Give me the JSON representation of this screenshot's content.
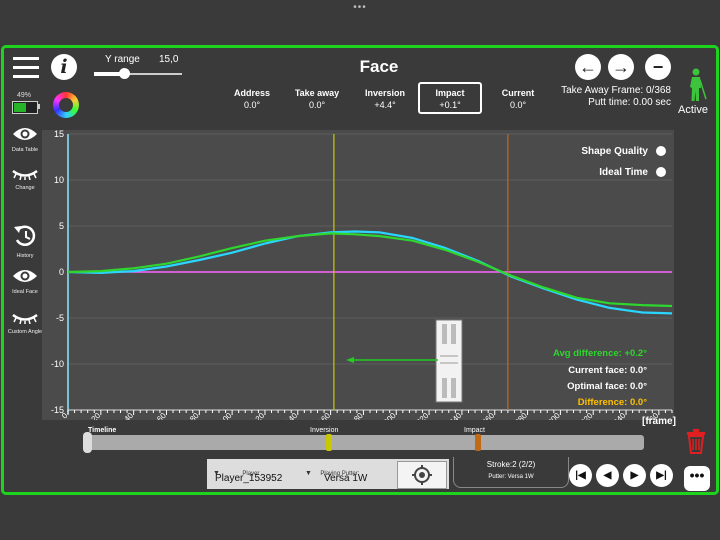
{
  "header": {
    "title": "Face",
    "y_range_label": "Y range",
    "y_range_value": "15,0",
    "battery": "49%",
    "status": "Active"
  },
  "metrics": [
    {
      "label": "Address",
      "value": "0.0°"
    },
    {
      "label": "Take away",
      "value": "0.0°"
    },
    {
      "label": "Inversion",
      "value": "+4.4°"
    },
    {
      "label": "Impact",
      "value": "+0.1°",
      "selected": true
    },
    {
      "label": "Current",
      "value": "0.0°"
    }
  ],
  "take_away": {
    "frame": "Take Away Frame: 0/368",
    "putt_time": "Putt time: 0.00 sec"
  },
  "side_menu": [
    {
      "label": "Data Table",
      "icon": "eye-icon"
    },
    {
      "label": "Change",
      "icon": "closed-eye-icon"
    },
    {
      "label": "History",
      "icon": "history-icon"
    },
    {
      "label": "Ideal Face",
      "icon": "eye-icon"
    },
    {
      "label": "Custom Angle",
      "icon": "closed-eye-icon"
    }
  ],
  "toggles": {
    "shape_quality": "Shape Quality",
    "ideal_time": "Ideal Time"
  },
  "stats": {
    "avg_difference": "Avg difference: +0.2°",
    "current_face": "Current face: 0.0°",
    "optimal_face": "Optimal face: 0.0°",
    "difference": "Difference: 0.0°"
  },
  "x_unit": "[frame]",
  "timeline": {
    "label": "Timeline",
    "inversion": "Inversion",
    "impact": "Impact"
  },
  "player": {
    "player_label": "Player",
    "player_value": "Player_153952",
    "putter_label": "Playing Putter:",
    "putter_value": "Versa 1W"
  },
  "stroke": {
    "main": "Stroke:2 (2/2)",
    "putter": "Putter: Versa 1W"
  },
  "colors": {
    "frame": "#1ed31e",
    "series_current": "#29d6ff",
    "series_ideal": "#2ed62e",
    "zero_line": "#ff66ff",
    "inversion_line": "#c8c800",
    "impact_line": "#c06a18",
    "difference": "#ffc000"
  },
  "chart_data": {
    "type": "line",
    "xlabel": "[frame]",
    "xlim": [
      0,
      368
    ],
    "ylim": [
      -15,
      15
    ],
    "x_ticks": [
      0,
      20,
      40,
      60,
      80,
      100,
      120,
      140,
      160,
      180,
      200,
      220,
      240,
      260,
      280,
      300,
      320,
      340,
      360
    ],
    "y_ticks": [
      -15,
      -10,
      -5,
      0,
      5,
      10,
      15
    ],
    "markers": [
      {
        "name": "Inversion",
        "x": 162
      },
      {
        "name": "Impact",
        "x": 268
      }
    ],
    "series": [
      {
        "name": "current",
        "x": [
          0,
          20,
          40,
          60,
          80,
          100,
          120,
          140,
          160,
          175,
          190,
          210,
          230,
          250,
          270,
          290,
          310,
          330,
          350,
          368
        ],
        "y": [
          0,
          -0.1,
          0.1,
          0.6,
          1.3,
          2.1,
          3.1,
          3.9,
          4.3,
          4.4,
          4.3,
          3.7,
          2.6,
          1.2,
          -0.5,
          -1.8,
          -3.0,
          -3.9,
          -4.4,
          -4.5
        ]
      },
      {
        "name": "ideal",
        "x": [
          0,
          20,
          40,
          60,
          80,
          100,
          120,
          140,
          160,
          175,
          190,
          210,
          230,
          250,
          270,
          290,
          310,
          330,
          350,
          368
        ],
        "y": [
          0,
          0.1,
          0.4,
          0.9,
          1.7,
          2.6,
          3.4,
          3.9,
          4.2,
          4.1,
          3.9,
          3.4,
          2.4,
          1.1,
          -0.4,
          -1.7,
          -2.8,
          -3.4,
          -3.6,
          -3.7
        ]
      }
    ]
  }
}
